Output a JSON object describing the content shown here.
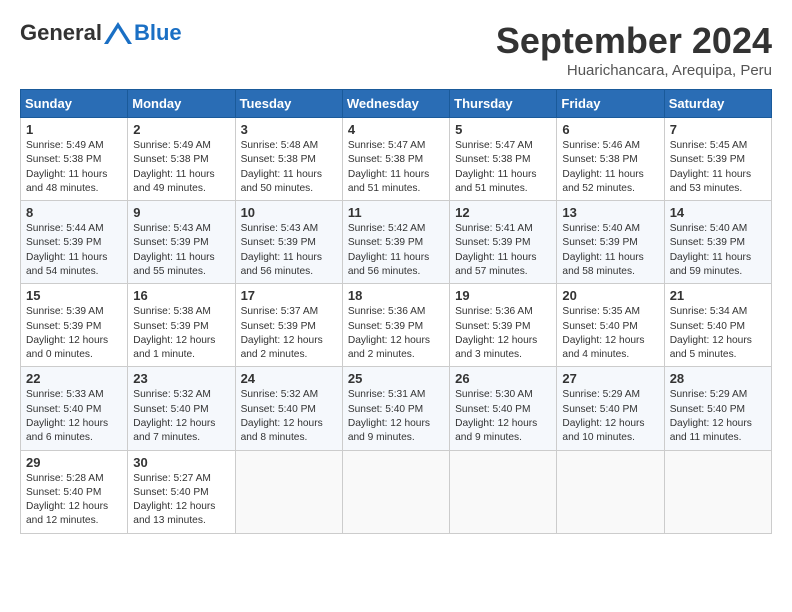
{
  "header": {
    "logo_general": "General",
    "logo_blue": "Blue",
    "month_title": "September 2024",
    "location": "Huarichancara, Arequipa, Peru"
  },
  "calendar": {
    "days_of_week": [
      "Sunday",
      "Monday",
      "Tuesday",
      "Wednesday",
      "Thursday",
      "Friday",
      "Saturday"
    ],
    "weeks": [
      [
        {
          "day": "",
          "empty": true
        },
        {
          "day": "2",
          "sunrise": "5:49 AM",
          "sunset": "5:38 PM",
          "daylight": "11 hours and 49 minutes."
        },
        {
          "day": "3",
          "sunrise": "5:48 AM",
          "sunset": "5:38 PM",
          "daylight": "11 hours and 50 minutes."
        },
        {
          "day": "4",
          "sunrise": "5:47 AM",
          "sunset": "5:38 PM",
          "daylight": "11 hours and 51 minutes."
        },
        {
          "day": "5",
          "sunrise": "5:47 AM",
          "sunset": "5:38 PM",
          "daylight": "11 hours and 51 minutes."
        },
        {
          "day": "6",
          "sunrise": "5:46 AM",
          "sunset": "5:38 PM",
          "daylight": "11 hours and 52 minutes."
        },
        {
          "day": "7",
          "sunrise": "5:45 AM",
          "sunset": "5:39 PM",
          "daylight": "11 hours and 53 minutes."
        }
      ],
      [
        {
          "day": "8",
          "sunrise": "5:44 AM",
          "sunset": "5:39 PM",
          "daylight": "11 hours and 54 minutes."
        },
        {
          "day": "9",
          "sunrise": "5:43 AM",
          "sunset": "5:39 PM",
          "daylight": "11 hours and 55 minutes."
        },
        {
          "day": "10",
          "sunrise": "5:43 AM",
          "sunset": "5:39 PM",
          "daylight": "11 hours and 56 minutes."
        },
        {
          "day": "11",
          "sunrise": "5:42 AM",
          "sunset": "5:39 PM",
          "daylight": "11 hours and 56 minutes."
        },
        {
          "day": "12",
          "sunrise": "5:41 AM",
          "sunset": "5:39 PM",
          "daylight": "11 hours and 57 minutes."
        },
        {
          "day": "13",
          "sunrise": "5:40 AM",
          "sunset": "5:39 PM",
          "daylight": "11 hours and 58 minutes."
        },
        {
          "day": "14",
          "sunrise": "5:40 AM",
          "sunset": "5:39 PM",
          "daylight": "11 hours and 59 minutes."
        }
      ],
      [
        {
          "day": "15",
          "sunrise": "5:39 AM",
          "sunset": "5:39 PM",
          "daylight": "12 hours and 0 minutes."
        },
        {
          "day": "16",
          "sunrise": "5:38 AM",
          "sunset": "5:39 PM",
          "daylight": "12 hours and 1 minute."
        },
        {
          "day": "17",
          "sunrise": "5:37 AM",
          "sunset": "5:39 PM",
          "daylight": "12 hours and 2 minutes."
        },
        {
          "day": "18",
          "sunrise": "5:36 AM",
          "sunset": "5:39 PM",
          "daylight": "12 hours and 2 minutes."
        },
        {
          "day": "19",
          "sunrise": "5:36 AM",
          "sunset": "5:39 PM",
          "daylight": "12 hours and 3 minutes."
        },
        {
          "day": "20",
          "sunrise": "5:35 AM",
          "sunset": "5:40 PM",
          "daylight": "12 hours and 4 minutes."
        },
        {
          "day": "21",
          "sunrise": "5:34 AM",
          "sunset": "5:40 PM",
          "daylight": "12 hours and 5 minutes."
        }
      ],
      [
        {
          "day": "22",
          "sunrise": "5:33 AM",
          "sunset": "5:40 PM",
          "daylight": "12 hours and 6 minutes."
        },
        {
          "day": "23",
          "sunrise": "5:32 AM",
          "sunset": "5:40 PM",
          "daylight": "12 hours and 7 minutes."
        },
        {
          "day": "24",
          "sunrise": "5:32 AM",
          "sunset": "5:40 PM",
          "daylight": "12 hours and 8 minutes."
        },
        {
          "day": "25",
          "sunrise": "5:31 AM",
          "sunset": "5:40 PM",
          "daylight": "12 hours and 9 minutes."
        },
        {
          "day": "26",
          "sunrise": "5:30 AM",
          "sunset": "5:40 PM",
          "daylight": "12 hours and 9 minutes."
        },
        {
          "day": "27",
          "sunrise": "5:29 AM",
          "sunset": "5:40 PM",
          "daylight": "12 hours and 10 minutes."
        },
        {
          "day": "28",
          "sunrise": "5:29 AM",
          "sunset": "5:40 PM",
          "daylight": "12 hours and 11 minutes."
        }
      ],
      [
        {
          "day": "29",
          "sunrise": "5:28 AM",
          "sunset": "5:40 PM",
          "daylight": "12 hours and 12 minutes."
        },
        {
          "day": "30",
          "sunrise": "5:27 AM",
          "sunset": "5:40 PM",
          "daylight": "12 hours and 13 minutes."
        },
        {
          "day": "",
          "empty": true
        },
        {
          "day": "",
          "empty": true
        },
        {
          "day": "",
          "empty": true
        },
        {
          "day": "",
          "empty": true
        },
        {
          "day": "",
          "empty": true
        }
      ]
    ],
    "day1": {
      "day": "1",
      "sunrise": "5:49 AM",
      "sunset": "5:38 PM",
      "daylight": "11 hours and 48 minutes."
    }
  }
}
